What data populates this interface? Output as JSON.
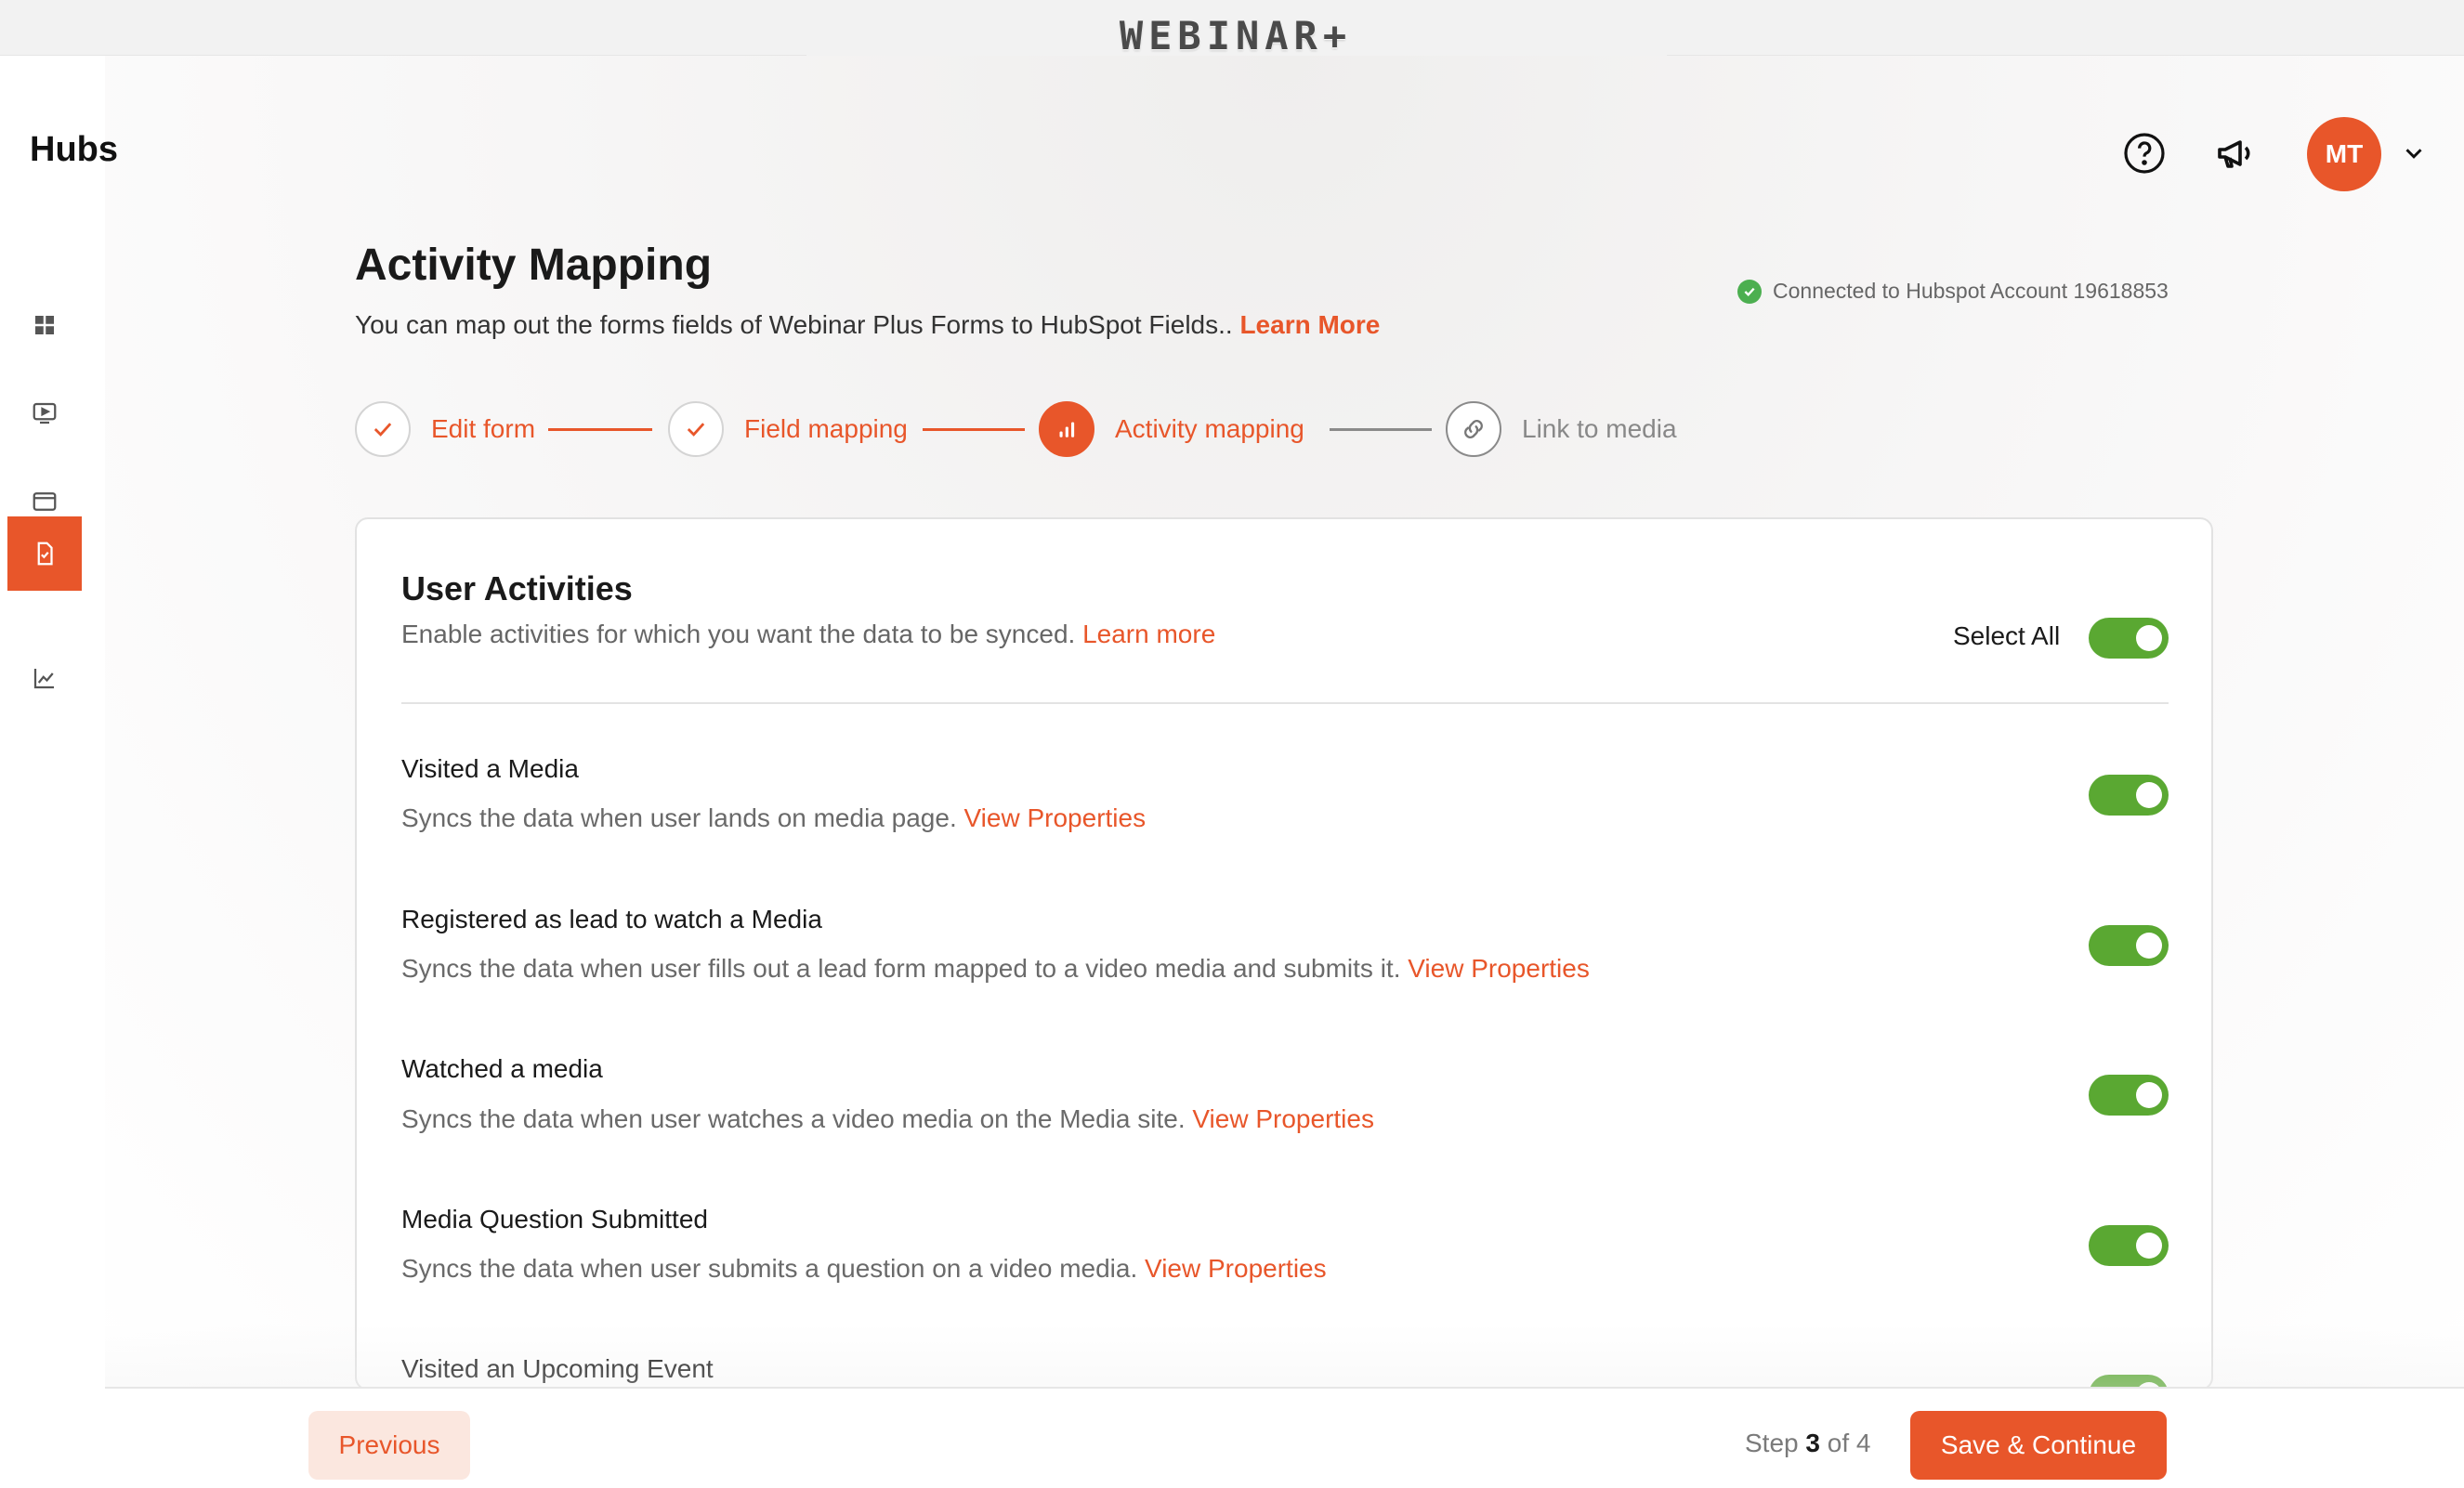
{
  "brand": {
    "logo_text": "WEBINAR+"
  },
  "sidebar": {
    "title": "Hubs",
    "items": [
      {
        "name": "dashboard",
        "icon": "grid-icon"
      },
      {
        "name": "media",
        "icon": "video-screen-icon"
      },
      {
        "name": "pages",
        "icon": "browser-window-icon"
      },
      {
        "name": "forms",
        "icon": "document-check-icon",
        "active": true
      },
      {
        "name": "analytics",
        "icon": "line-chart-icon"
      }
    ]
  },
  "header": {
    "help_icon": "help-circle-icon",
    "announcements_icon": "megaphone-icon",
    "avatar_initials": "MT"
  },
  "page": {
    "title": "Activity Mapping",
    "subtitle": "You can map out the forms fields of Webinar Plus Forms to HubSpot Fields..",
    "learn_more": "Learn More",
    "connection_status": "Connected to Hubspot Account 19618853"
  },
  "stepper": {
    "steps": [
      {
        "label": "Edit form",
        "state": "done"
      },
      {
        "label": "Field mapping",
        "state": "done"
      },
      {
        "label": "Activity mapping",
        "state": "current"
      },
      {
        "label": "Link to media",
        "state": "upcoming"
      }
    ]
  },
  "card": {
    "title": "User Activities",
    "subtitle": "Enable activities for which you want the data to be synced.",
    "learn_more": "Learn more",
    "select_all_label": "Select All",
    "select_all_enabled": true,
    "activities": [
      {
        "title": "Visited a Media",
        "description": "Syncs the data when user lands on media page.",
        "link": "View Properties",
        "enabled": true
      },
      {
        "title": "Registered as lead to watch a Media",
        "description": "Syncs the data when user fills out a lead form mapped to a video media and submits it.",
        "link": "View Properties",
        "enabled": true
      },
      {
        "title": "Watched a media",
        "description": "Syncs the data when user watches a video media on the Media site.",
        "link": "View Properties",
        "enabled": true
      },
      {
        "title": "Media Question Submitted",
        "description": "Syncs the data when user submits a question on a video media.",
        "link": "View Properties",
        "enabled": true
      },
      {
        "title": "Visited an Upcoming Event",
        "description": "",
        "link": "",
        "enabled": true
      }
    ]
  },
  "footer": {
    "previous_label": "Previous",
    "step_prefix": "Step",
    "step_current": "3",
    "step_sep": "of",
    "step_total": "4",
    "save_label": "Save & Continue"
  },
  "colors": {
    "accent": "#e8562a",
    "toggle_on": "#5aa832",
    "connected": "#4caf50"
  }
}
